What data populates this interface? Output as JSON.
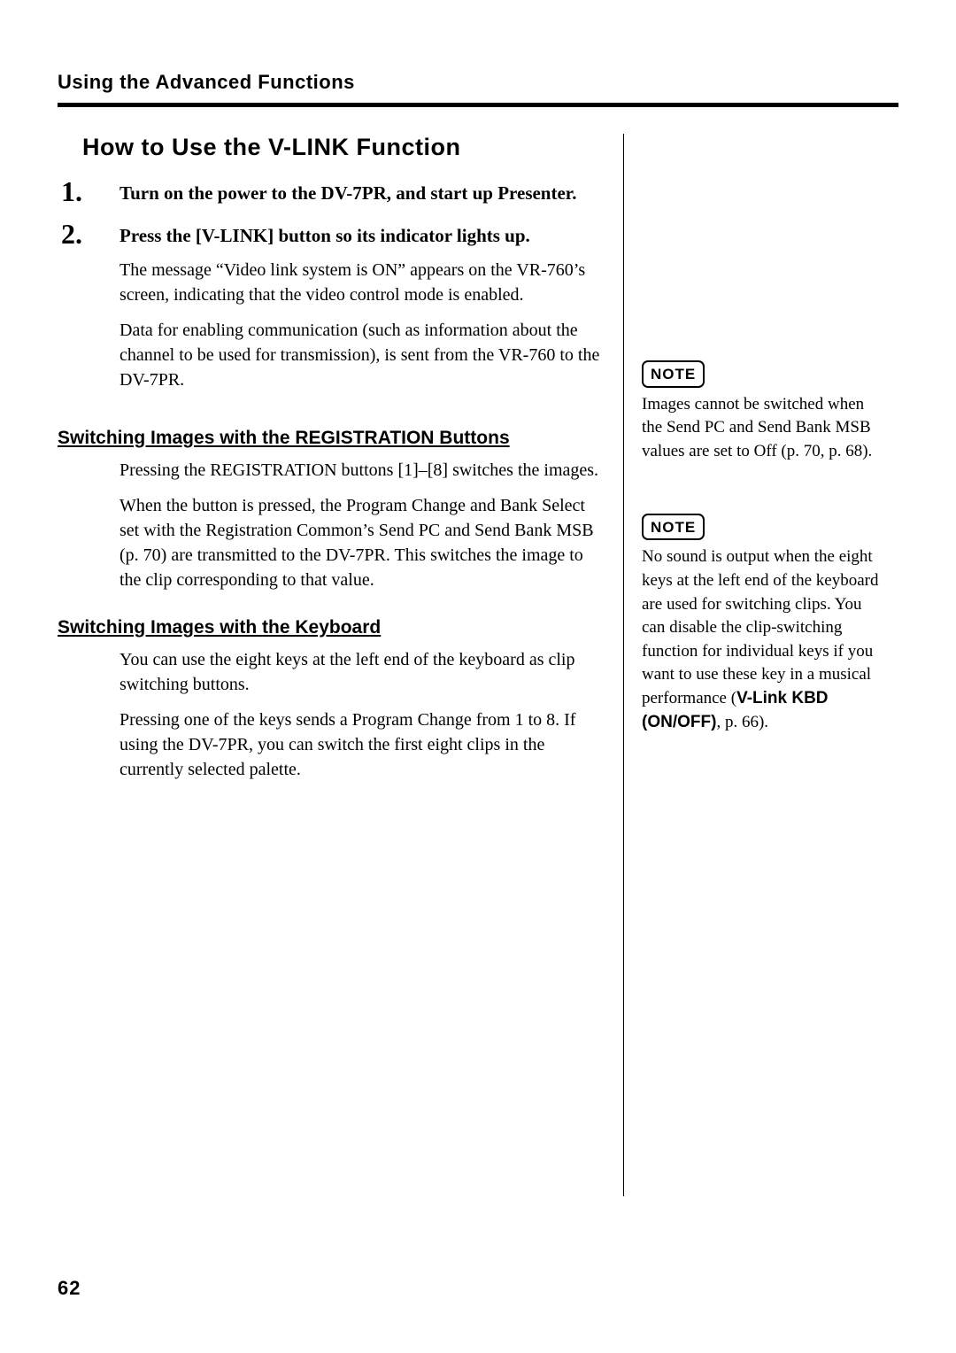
{
  "header": "Using the Advanced Functions",
  "section_title": "How to Use the V-LINK Function",
  "steps": [
    {
      "num": "1",
      "title": "Turn on the power to the DV-7PR, and start up Presenter."
    },
    {
      "num": "2",
      "title": "Press the [V-LINK] button so its indicator lights up.",
      "paras": [
        "The message “Video link system is ON” appears on the VR-760’s screen, indicating that the video control mode is enabled.",
        "Data for enabling communication (such as information about the channel to be used for transmission), is sent from the VR-760 to the DV-7PR."
      ]
    }
  ],
  "sub1": {
    "heading": "Switching Images with the REGISTRATION Buttons",
    "paras": [
      "Pressing the REGISTRATION buttons [1]–[8] switches the images.",
      "When the button is pressed, the Program Change and Bank Select set with the Registration Common’s Send PC and Send Bank MSB (p. 70) are transmitted to the DV-7PR. This switches the image to the clip corresponding to that value."
    ]
  },
  "sub2": {
    "heading": "Switching Images with the Keyboard",
    "paras": [
      "You can use the eight keys at the left end of the keyboard as clip switching buttons.",
      "Pressing one of the keys sends a Program Change from 1 to 8. If using the DV-7PR, you can switch the first eight clips in the currently selected palette."
    ]
  },
  "notes": {
    "label": "NOTE",
    "n1": "Images cannot be switched when the Send PC and Send Bank MSB values are set to Off (p. 70, p. 68).",
    "n2_a": "No sound is output when the eight keys at the left end of the keyboard are used for switching clips. You can disable the clip-switching function for individual keys if you want to use these key in a musical performance (",
    "n2_bold": "V-Link KBD (ON/OFF)",
    "n2_b": ", p. 66)."
  },
  "page_number": "62"
}
